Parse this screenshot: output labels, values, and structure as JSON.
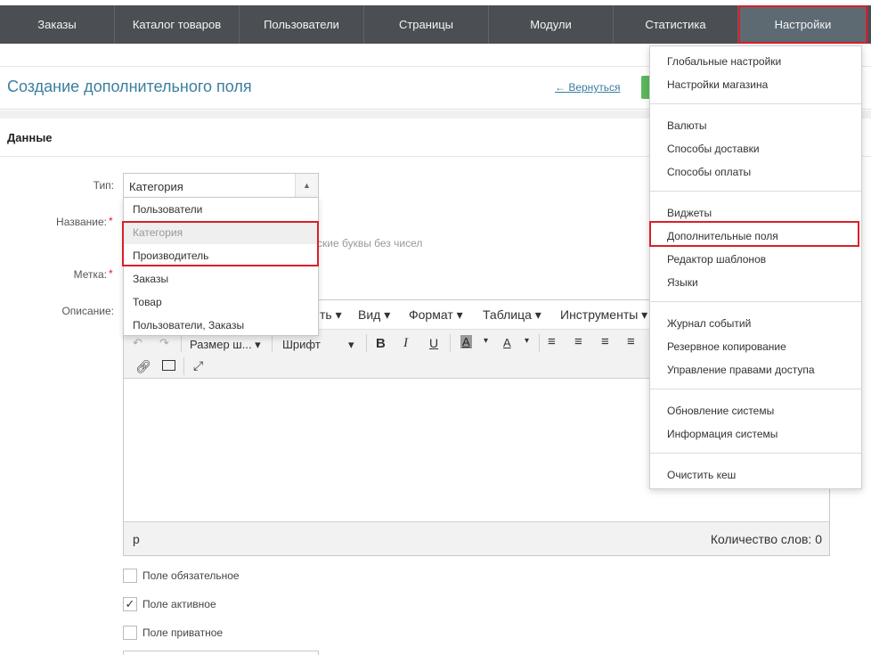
{
  "nav": {
    "items": [
      "Заказы",
      "Каталог товаров",
      "Пользователи",
      "Страницы",
      "Модули",
      "Статистика",
      "Настройки"
    ],
    "active": "Настройки"
  },
  "header": {
    "title": "Создание дополнительного поля",
    "back_label": "← Вернуться"
  },
  "section": {
    "title": "Данные"
  },
  "form": {
    "type_label": "Тип:",
    "type_value": "Категория",
    "name_label": "Название:",
    "tag_label": "Метка:",
    "desc_label": "Описание:",
    "required_mark": "*",
    "hint_fragment": "ские буквы без чисел",
    "type_options": [
      "Пользователи",
      "Категория",
      "Производитель",
      "Заказы",
      "Товар",
      "Пользователи, Заказы"
    ]
  },
  "editor": {
    "menubar": [
      "ть",
      "Вид",
      "Формат",
      "Таблица",
      "Инструменты"
    ],
    "font_size_label": "Размер ш...",
    "font_label": "Шрифт",
    "status_path": "p",
    "word_count": "Количество слов: 0"
  },
  "checkboxes": [
    {
      "label": "Поле обязательное",
      "checked": false
    },
    {
      "label": "Поле активное",
      "checked": true
    },
    {
      "label": "Поле приватное",
      "checked": false
    }
  ],
  "settings_menu": {
    "groups": [
      [
        "Глобальные настройки",
        "Настройки магазина"
      ],
      [
        "Валюты",
        "Способы доставки",
        "Способы оплаты"
      ],
      [
        "Виджеты",
        "Дополнительные поля",
        "Редактор шаблонов",
        "Языки"
      ],
      [
        "Журнал событий",
        "Резервное копирование",
        "Управление правами доступа"
      ],
      [
        "Обновление системы",
        "Информация системы"
      ],
      [
        "Очистить кеш"
      ]
    ],
    "highlighted": "Дополнительные поля"
  },
  "colors": {
    "nav_bg": "#4b4f53",
    "accent": "#3b7ea0",
    "highlight": "#d8202a",
    "save_green": "#5cb85c"
  }
}
